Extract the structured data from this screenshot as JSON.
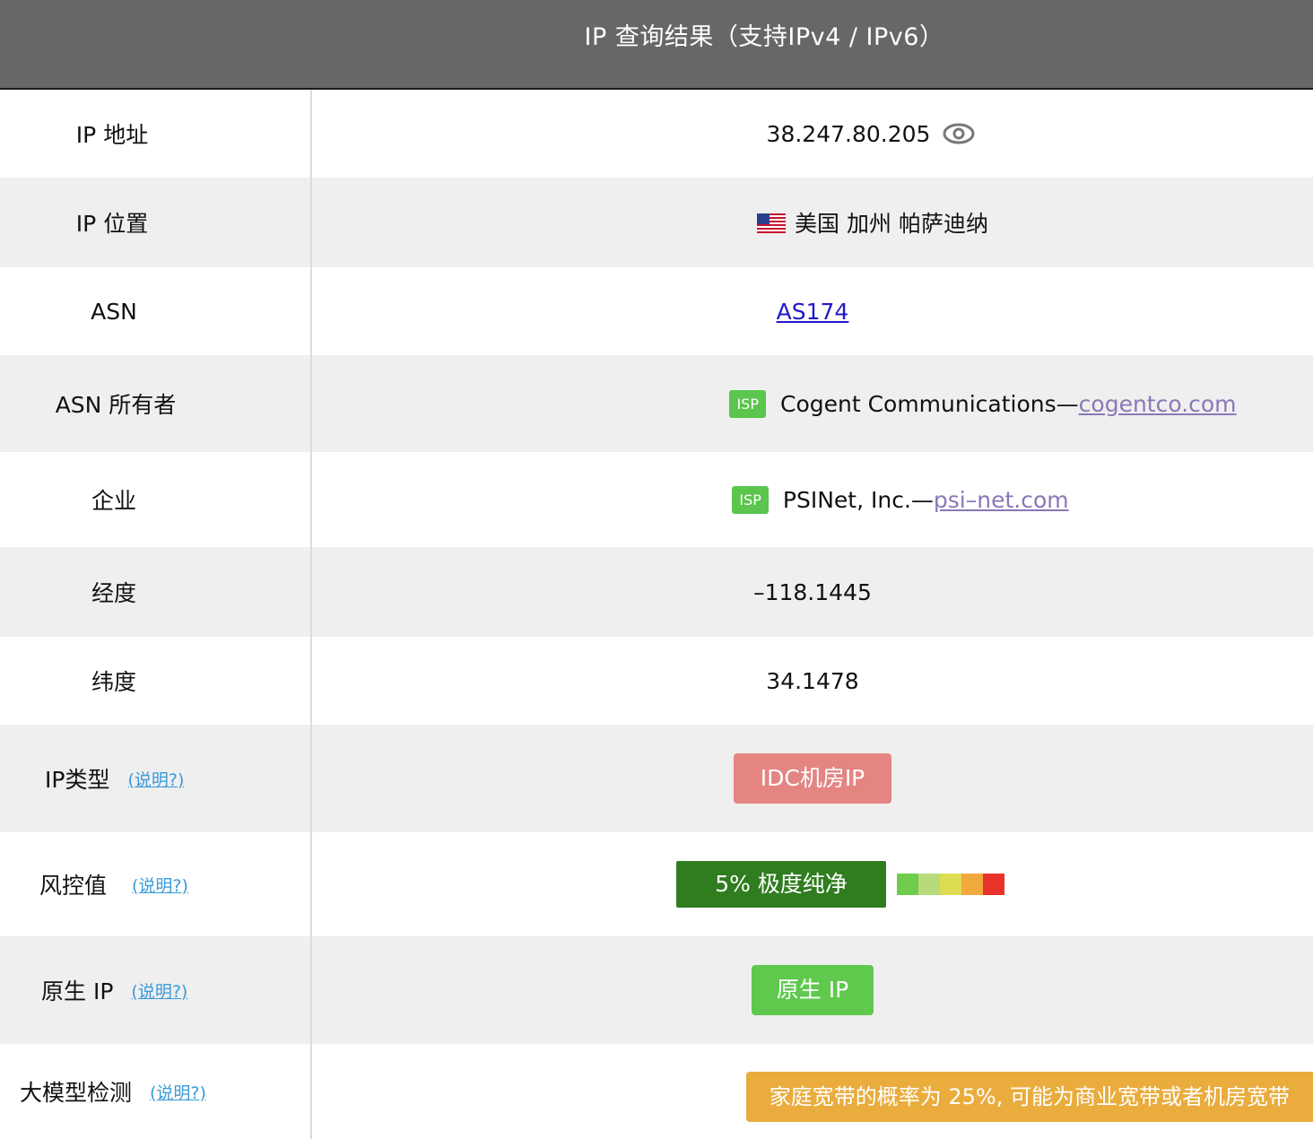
{
  "header": {
    "title": "IP 查询结果（支持IPv4 / IPv6）"
  },
  "rows": {
    "ip": {
      "label": "IP 地址",
      "value": "38.247.80.205",
      "icon": "eye-icon"
    },
    "location": {
      "label": "IP 位置",
      "flag": "us-flag-icon",
      "value": "美国 加州 帕萨迪纳"
    },
    "asn": {
      "label": "ASN",
      "value": "AS174"
    },
    "asn_owner": {
      "label": "ASN 所有者",
      "badge": "ISP",
      "name": "Cogent Communications—",
      "link": "cogentco.com"
    },
    "company": {
      "label": "企业",
      "badge": "ISP",
      "name": "PSINet, Inc.—",
      "link": "psi–net.com"
    },
    "longitude": {
      "label": "经度",
      "value": "–118.1445"
    },
    "latitude": {
      "label": "纬度",
      "value": "34.1478"
    },
    "ip_type": {
      "label": "IP类型",
      "help": "(说明?)",
      "value": "IDC机房IP",
      "color": "#e48582"
    },
    "risk": {
      "label": "风控值",
      "help": "(说明?)",
      "value": "5%   极度纯净",
      "color": "#2f7d1f",
      "scale_colors": [
        "#6fcb4b",
        "#b7db7b",
        "#dedc52",
        "#f0a93c",
        "#e8332a"
      ]
    },
    "native": {
      "label": "原生 IP",
      "help": "(说明?)",
      "value": "原生 IP",
      "color": "#5ec94d"
    },
    "llm": {
      "label": "大模型检测",
      "help": "(说明?)",
      "value": "家庭宽带的概率为 25%, 可能为商业宽带或者机房宽带",
      "color": "#e9ac3d"
    }
  }
}
